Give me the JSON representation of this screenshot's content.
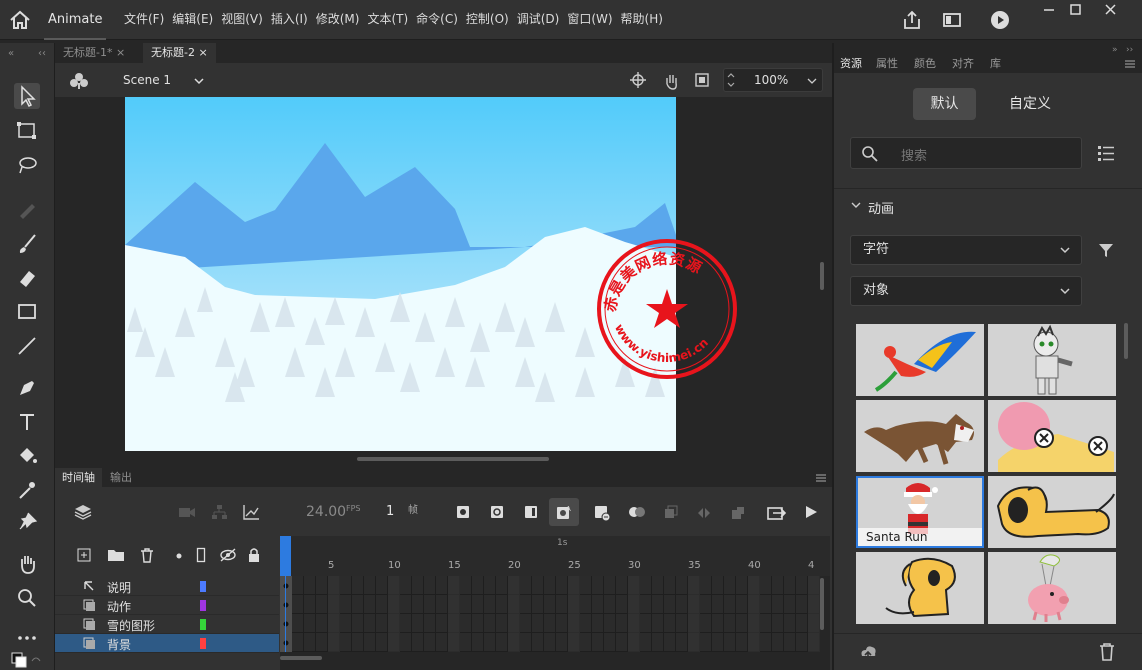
{
  "app": {
    "name": "Animate"
  },
  "menu": [
    "文件(F)",
    "编辑(E)",
    "视图(V)",
    "插入(I)",
    "修改(M)",
    "文本(T)",
    "命令(C)",
    "控制(O)",
    "调试(D)",
    "窗口(W)",
    "帮助(H)"
  ],
  "doc_tabs": [
    {
      "label": "无标题-1*",
      "active": false
    },
    {
      "label": "无标题-2",
      "active": true
    }
  ],
  "stage_bar": {
    "scene": "Scene 1",
    "zoom": "100%"
  },
  "watermark": {
    "text_top": "赤是美网络资源",
    "text_bottom": "www.yishimei.cn",
    "color": "#e8141c"
  },
  "timeline": {
    "tabs": [
      "时间轴",
      "输出"
    ],
    "fps": "24.00",
    "fps_unit": "FPS",
    "frame": "1",
    "frame_unit": "帧",
    "ruler_second": "1s",
    "ruler": [
      "5",
      "10",
      "15",
      "20",
      "25",
      "30",
      "35",
      "40",
      "4"
    ],
    "layers": [
      {
        "name": "说明",
        "color": "#4c7bff",
        "icon": "pointer-icon",
        "selected": false
      },
      {
        "name": "动作",
        "color": "#a035e0",
        "icon": "layer-icon",
        "selected": false
      },
      {
        "name": "雪的图形",
        "color": "#35d43a",
        "icon": "layer-icon",
        "selected": false
      },
      {
        "name": "背景",
        "color": "#ff4040",
        "icon": "layer-icon",
        "selected": true
      }
    ]
  },
  "assets": {
    "tabs": [
      "资源",
      "属性",
      "颜色",
      "对齐",
      "库"
    ],
    "segment": {
      "default": "默认",
      "custom": "自定义"
    },
    "search_placeholder": "搜索",
    "section": "动画",
    "filter1": "字符",
    "filter2": "对象",
    "thumbs": [
      {
        "name": "parrot-thumb",
        "caption": ""
      },
      {
        "name": "mummy-thumb",
        "caption": ""
      },
      {
        "name": "wolf-thumb",
        "caption": ""
      },
      {
        "name": "cheese-thumb",
        "caption": ""
      },
      {
        "name": "santa-thumb",
        "caption": "Santa Run",
        "selected": true
      },
      {
        "name": "dog-lying-thumb",
        "caption": ""
      },
      {
        "name": "dog-sitting-thumb",
        "caption": ""
      },
      {
        "name": "pig-balloon-thumb",
        "caption": ""
      }
    ]
  },
  "colors": {
    "accent": "#2d7be0",
    "selected_row": "#2e5a86",
    "sky_top": "#4ec9fb",
    "snow": "#eefcff"
  }
}
